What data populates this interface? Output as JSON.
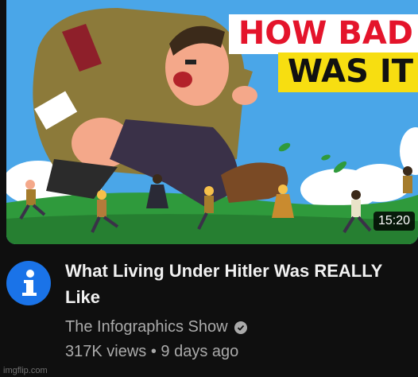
{
  "thumbnail": {
    "headline_line1": "HOW BAD",
    "headline_line2": "WAS IT",
    "duration": "15:20"
  },
  "video": {
    "title": "What Living Under Hitler Was REALLY Like",
    "channel": "The Infographics Show",
    "views": "317K views",
    "separator": "•",
    "age": "9 days ago"
  },
  "channel_avatar": {
    "icon": "info-icon",
    "color": "#1a73e8"
  },
  "watermark": "imgflip.com"
}
